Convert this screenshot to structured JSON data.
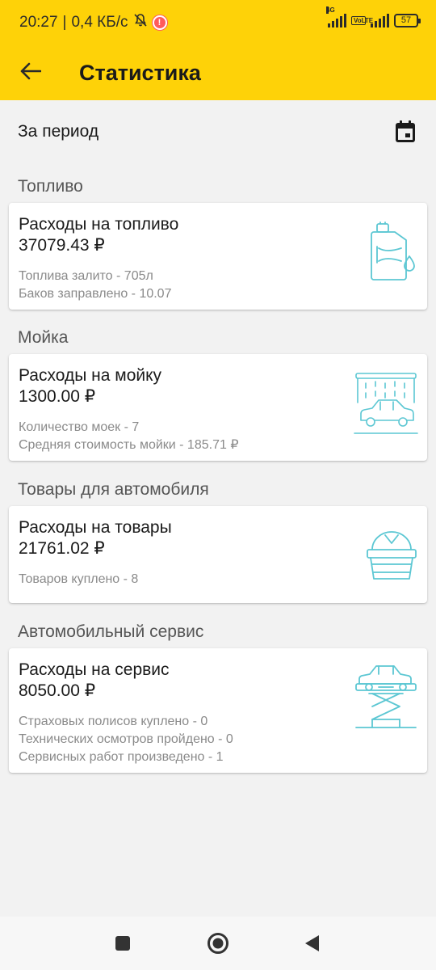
{
  "status_bar": {
    "time": "20:27",
    "speed": "0,4 КБ/с",
    "network": "4G",
    "volte": "VoLTE",
    "battery": "57"
  },
  "app_bar": {
    "title": "Статистика"
  },
  "period": {
    "label": "За период"
  },
  "sections": [
    {
      "title": "Топливо",
      "card_title": "Расходы на топливо",
      "amount": "37079.43 ₽",
      "details": [
        "Топлива залито - 705л",
        "Баков заправлено - 10.07"
      ]
    },
    {
      "title": "Мойка",
      "card_title": "Расходы на мойку",
      "amount": "1300.00 ₽",
      "details": [
        "Количество моек - 7",
        "Средняя стоимость мойки - 185.71 ₽"
      ]
    },
    {
      "title": "Товары для автомобиля",
      "card_title": "Расходы на товары",
      "amount": "21761.02 ₽",
      "details": [
        "Товаров куплено - 8"
      ]
    },
    {
      "title": "Автомобильный сервис",
      "card_title": "Расходы на сервис",
      "amount": "8050.00 ₽",
      "details": [
        "Страховых полисов куплено - 0",
        "Технических осмотров пройдено - 0",
        "Сервисных работ произведено - 1"
      ]
    }
  ],
  "colors": {
    "accent": "#fed208",
    "icon_teal": "#5cc7d3",
    "background": "#f2f2f2"
  },
  "icons": {
    "back": "arrow-left-icon",
    "calendar": "calendar-icon",
    "fuel": "fuel-canister-icon",
    "wash": "car-wash-icon",
    "goods": "basket-icon",
    "service": "car-lift-icon"
  }
}
